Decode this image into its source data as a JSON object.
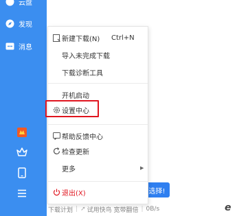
{
  "sidebar": {
    "items": [
      {
        "label": "云盘",
        "icon": "cloud-icon"
      },
      {
        "label": "发现",
        "icon": "compass-icon"
      },
      {
        "label": "消息",
        "icon": "message-icon"
      }
    ],
    "bottom_icons": [
      "game-icon",
      "crown-icon",
      "phone-icon",
      "menu-icon"
    ]
  },
  "menu": {
    "items": [
      {
        "label": "新建下载(N)",
        "shortcut": "Ctrl+N",
        "icon": "new-download-icon"
      },
      {
        "label": "导入未完成下载"
      },
      {
        "label": "下载诊断工具"
      },
      {
        "label": "开机启动"
      },
      {
        "label": "设置中心",
        "icon": "gear-icon"
      },
      {
        "label": "帮助反馈中心",
        "icon": "feedback-icon"
      },
      {
        "label": "检查更新",
        "icon": "refresh-icon"
      },
      {
        "label": "更多"
      },
      {
        "label": "退出(X)",
        "icon": "power-icon"
      }
    ]
  },
  "main": {
    "button_partial": "选择!"
  },
  "footer": {
    "plan": "下载计划",
    "trial": "试用快鸟 宽带翻倍",
    "speed": "0B/s"
  },
  "colors": {
    "sidebar": "#3b8ef0",
    "highlight": "#e0141e",
    "exit": "#e0141e",
    "button": "#2f7ff0"
  }
}
